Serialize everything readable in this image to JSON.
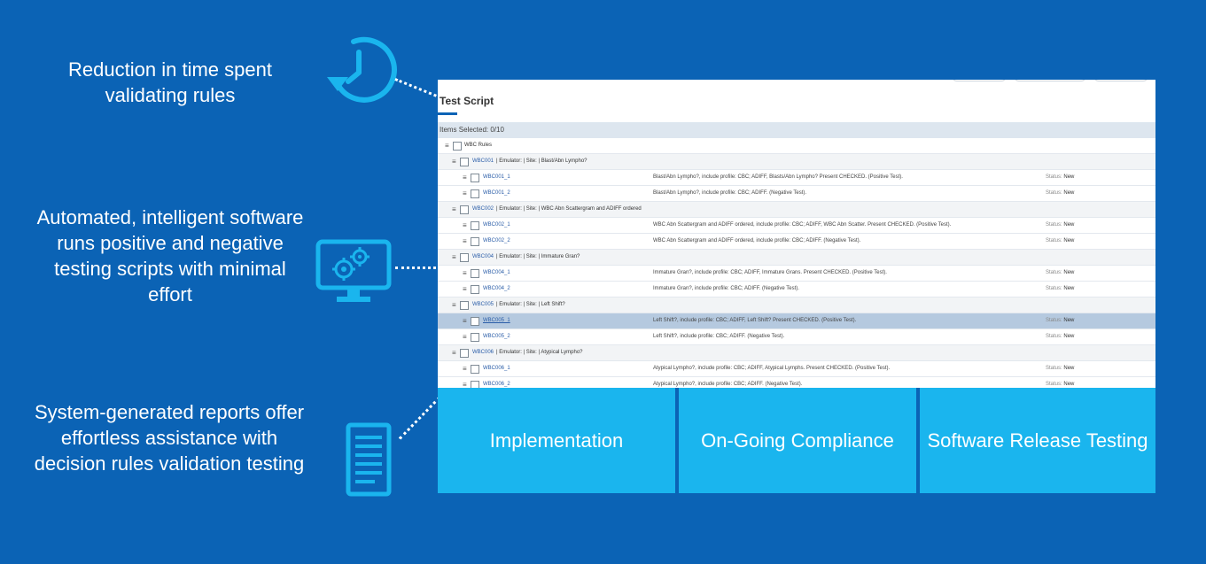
{
  "features": [
    {
      "text": "Reduction in time spent validating rules",
      "icon": "clock-refresh-icon"
    },
    {
      "text": "Automated, intelligent software runs positive and negative testing scripts with minimal effort",
      "icon": "monitor-gears-icon"
    },
    {
      "text": "System-generated reports offer effortless assistance with decision rules validation testing",
      "icon": "document-report-icon"
    }
  ],
  "screenshot": {
    "title": "Test Script",
    "items_selected": "Items Selected: 0/10",
    "root_label": "WBC Rules",
    "groups": [
      {
        "id": "WBC001",
        "meta": "| Emulator: | Site: | Blast/Abn Lympho?",
        "items": [
          {
            "id": "WBC001_1",
            "desc": "Blast/Abn Lympho?, include profile: CBC; ADIFF, Blasts/Abn Lympho? Present CHECKED. (Positive Test).",
            "status_label": "Status:",
            "status": "New"
          },
          {
            "id": "WBC001_2",
            "desc": "Blast/Abn Lympho?, include profile: CBC; ADIFF. (Negative Test).",
            "status_label": "Status:",
            "status": "New"
          }
        ]
      },
      {
        "id": "WBC002",
        "meta": "| Emulator: | Site: | WBC Abn Scattergram and ADIFF ordered",
        "items": [
          {
            "id": "WBC002_1",
            "desc": "WBC Abn Scattergram and ADIFF ordered, include profile: CBC; ADIFF, WBC Abn Scatter. Present CHECKED. (Positive Test).",
            "status_label": "Status:",
            "status": "New"
          },
          {
            "id": "WBC002_2",
            "desc": "WBC Abn Scattergram and ADIFF ordered, include profile: CBC; ADIFF. (Negative Test).",
            "status_label": "Status:",
            "status": "New"
          }
        ]
      },
      {
        "id": "WBC004",
        "meta": "| Emulator: | Site: | Immature Gran?",
        "items": [
          {
            "id": "WBC004_1",
            "desc": "Immature Gran?, include profile: CBC; ADIFF, Immature Grans. Present CHECKED. (Positive Test).",
            "status_label": "Status:",
            "status": "New"
          },
          {
            "id": "WBC004_2",
            "desc": "Immature Gran?, include profile: CBC; ADIFF. (Negative Test).",
            "status_label": "Status:",
            "status": "New"
          }
        ]
      },
      {
        "id": "WBC005",
        "meta": "| Emulator: | Site: | Left Shift?",
        "items": [
          {
            "id": "WBC005_1",
            "desc": "Left Shift?, include profile: CBC; ADIFF, Left Shift? Present CHECKED. (Positive Test).",
            "status_label": "Status:",
            "status": "New"
          },
          {
            "id": "WBC005_2",
            "desc": "Left Shift?, include profile: CBC; ADIFF. (Negative Test).",
            "status_label": "Status:",
            "status": "New"
          }
        ]
      },
      {
        "id": "WBC006",
        "meta": "| Emulator: | Site: | Atypical Lympho?",
        "items": [
          {
            "id": "WBC006_1",
            "desc": "Atypical Lympho?, include profile: CBC; ADIFF, Atypical Lymphs. Present CHECKED. (Positive Test).",
            "status_label": "Status:",
            "status": "New"
          },
          {
            "id": "WBC006_2",
            "desc": "Atypical Lympho?, include profile: CBC; ADIFF. (Negative Test).",
            "status_label": "Status:",
            "status": "New"
          }
        ]
      }
    ]
  },
  "tiles": [
    "Implementation",
    "On-Going Compliance",
    "Software Release Testing"
  ],
  "colors": {
    "background": "#0b63b5",
    "tile": "#1ab5ee",
    "icon": "#1ab5ee"
  }
}
